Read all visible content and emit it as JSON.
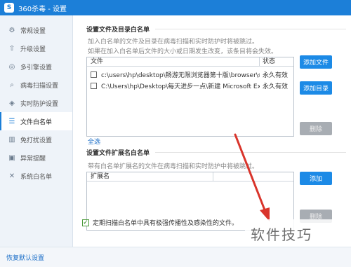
{
  "window": {
    "title": "360杀毒 - 设置",
    "logo_glyph": "S"
  },
  "sidebar": {
    "items": [
      {
        "label": "常规设置",
        "icon": "gear-icon",
        "glyph": "⚙"
      },
      {
        "label": "升级设置",
        "icon": "upload-icon",
        "glyph": "⇧"
      },
      {
        "label": "多引擎设置",
        "icon": "engine-icon",
        "glyph": "◎"
      },
      {
        "label": "病毒扫描设置",
        "icon": "search-icon",
        "glyph": "⌕"
      },
      {
        "label": "实时防护设置",
        "icon": "shield-icon",
        "glyph": "◈"
      },
      {
        "label": "文件白名单",
        "icon": "file-list-icon",
        "glyph": "☰"
      },
      {
        "label": "免打扰设置",
        "icon": "chart-icon",
        "glyph": "▥"
      },
      {
        "label": "异常提醒",
        "icon": "alert-icon",
        "glyph": "▣"
      },
      {
        "label": "系统白名单",
        "icon": "tools-icon",
        "glyph": "✕"
      }
    ],
    "active_index": 5
  },
  "section1": {
    "title": "设置文件及目录白名单",
    "desc1": "加入白名单的文件及目录在病毒扫描和实时防护时将被跳过。",
    "desc2": "如果在加入白名单后文件的大小或日期发生改变，该条目将会失效。",
    "columns": {
      "file": "文件",
      "status": "状态"
    },
    "rows": [
      {
        "path": "c:\\users\\hp\\desktop\\畅游无限浏览器第十版\\browser\\sy...",
        "status": "永久有效"
      },
      {
        "path": "C:\\Users\\hp\\Desktop\\每天进步一点\\新建 Microsoft Exc...",
        "status": "永久有效"
      }
    ],
    "add_file_label": "添加文件",
    "add_dir_label": "添加目录",
    "delete_label": "删除",
    "select_all_label": "全选"
  },
  "section2": {
    "title": "设置文件扩展名白名单",
    "desc": "带有白名单扩展名的文件在病毒扫描和实时防护中将被跳过。",
    "column": "扩展名",
    "add_label": "添加",
    "delete_label": "删除"
  },
  "option": {
    "checked": true,
    "check_glyph": "✓",
    "label": "定期扫描白名单中具有极强传播性及感染性的文件。"
  },
  "footer": {
    "restore_label": "恢复默认设置"
  },
  "watermark": "软件技巧",
  "colors": {
    "accent": "#1c7fd8",
    "sidebar_bg": "#eef3f9",
    "button_blue": "#1c8ae6",
    "button_disabled": "#a8adb3",
    "arrow_red": "#d9342b"
  }
}
